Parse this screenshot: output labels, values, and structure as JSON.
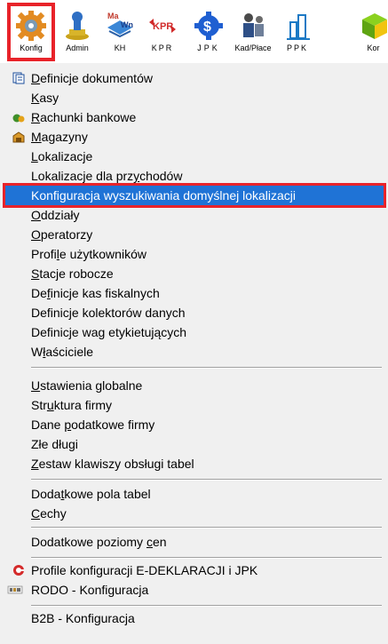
{
  "toolbar": {
    "buttons": [
      {
        "label": "Konfig"
      },
      {
        "label": "Admin"
      },
      {
        "label": "KH"
      },
      {
        "label": "KPR"
      },
      {
        "label": "JPK"
      },
      {
        "label": "Kad/Płace"
      },
      {
        "label": "PPK"
      },
      {
        "label": "Kor"
      }
    ],
    "kpr_icon_text": "KPR",
    "kh_icon_text": "Ma Wn"
  },
  "menu": {
    "items": [
      {
        "pre": "",
        "u": "D",
        "post": "efinicje dokumentów"
      },
      {
        "pre": "",
        "u": "K",
        "post": "asy"
      },
      {
        "pre": "",
        "u": "R",
        "post": "achunki bankowe"
      },
      {
        "pre": "",
        "u": "M",
        "post": "agazyny"
      },
      {
        "pre": "",
        "u": "L",
        "post": "okalizacje"
      },
      {
        "pre": "Lokalizacje dla prz",
        "u": "y",
        "post": "chodów"
      },
      {
        "pre": "Konfiguracja wyszukiwania domyślnej lokalizacji",
        "u": "",
        "post": ""
      },
      {
        "pre": "",
        "u": "O",
        "post": "ddziały"
      },
      {
        "pre": "",
        "u": "O",
        "post": "peratorzy"
      },
      {
        "pre": "Profi",
        "u": "l",
        "post": "e użytkowników"
      },
      {
        "pre": "",
        "u": "S",
        "post": "tacje robocze"
      },
      {
        "pre": "De",
        "u": "f",
        "post": "inicje kas fiskalnych"
      },
      {
        "pre": "Definicje kolektorów danych",
        "u": "",
        "post": ""
      },
      {
        "pre": "Definicje wag etykietujących",
        "u": "",
        "post": ""
      },
      {
        "pre": "W",
        "u": "ł",
        "post": "aściciele"
      },
      {
        "pre": "",
        "u": "U",
        "post": "stawienia globalne"
      },
      {
        "pre": "Str",
        "u": "u",
        "post": "ktura firmy"
      },
      {
        "pre": "Dane ",
        "u": "p",
        "post": "odatkowe firmy"
      },
      {
        "pre": "Złe długi",
        "u": "",
        "post": ""
      },
      {
        "pre": "",
        "u": "Z",
        "post": "estaw klawiszy obsługi tabel"
      },
      {
        "pre": "Doda",
        "u": "t",
        "post": "kowe pola tabel"
      },
      {
        "pre": "",
        "u": "C",
        "post": "echy"
      },
      {
        "pre": "Dodatkowe poziomy ",
        "u": "c",
        "post": "en"
      },
      {
        "pre": "Profile konfiguracji E-DEKLARACJI i JPK",
        "u": "",
        "post": ""
      },
      {
        "pre": "RODO - Konfiguracja",
        "u": "",
        "post": ""
      },
      {
        "pre": "B2B - Konfiguracja",
        "u": "",
        "post": ""
      }
    ]
  },
  "colors": {
    "highlight": "#1f73d6",
    "annotation_red": "#e8232a"
  }
}
